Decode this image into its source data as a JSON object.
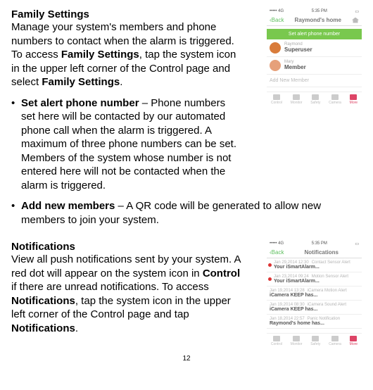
{
  "pageNumber": "12",
  "family": {
    "heading": "Family Settings",
    "intro_a": "Manage your system's members and phone numbers to contact when the alarm is  triggered. To access ",
    "intro_b": "Family Settings",
    "intro_c": ", tap the system icon in the upper left corner of the Control page and select ",
    "intro_d": "Family Settings",
    "intro_e": ".",
    "bullets": {
      "b1_bold": "Set alert phone number",
      "b1_rest": " – Phone numbers set here will be contacted by our automated phone call when the alarm is triggered. A maximum of three phone numbers can be set. Members of the system whose number is not entered here will not be contacted when the alarm is triggered.",
      "b2_bold": "Add new members",
      "b2_rest": " – A QR code will be generated to allow new members to join your system."
    }
  },
  "notifications": {
    "heading": "Notifications",
    "p_a": "View all push notifications sent by your system. A red dot will appear on the system icon in ",
    "p_b": "Control",
    "p_c": " if there are unread notifications. To access ",
    "p_d": "Notifications",
    "p_e": ", tap the system icon in the upper left corner of the Control page and tap ",
    "p_f": "Notifications",
    "p_g": "."
  },
  "phone1": {
    "status_left": "••••• 4G",
    "status_mid": "5:35 PM",
    "back": "Back",
    "title": "Raymond's home",
    "green": "Set alert phone number",
    "m1_name": "Raymond",
    "m1_role": "Superuser",
    "m2_name": "Mary",
    "m2_role": "Member",
    "add": "Add New Member",
    "tabs": {
      "t1": "Control",
      "t2": "Monitor",
      "t3": "Safety",
      "t4": "Camera",
      "t5": "More"
    }
  },
  "phone2": {
    "status_left": "••••• 4G",
    "status_mid": "5:35 PM",
    "back": "Back",
    "title": "Notifications",
    "rows": {
      "r1_date": "Jan 29,2014 12:30",
      "r1_type": "Contact Sensor Alert",
      "r1_msg": "Your iSmartAlarm...",
      "r2_date": "Jan 23,2014 09:24",
      "r2_type": "Motion Sensor Alert",
      "r2_msg": "Your iSmartAlarm...",
      "r3_date": "Jan 19,2014 13:28",
      "r3_type": "iCamera Motion Alert",
      "r3_msg": "iCamera KEEP has...",
      "r4_date": "Jan 19,2014 08:30",
      "r4_type": "iCamera Sound Alert",
      "r4_msg": "iCamera KEEP has...",
      "r5_date": "Jan 18,2014 22:57",
      "r5_type": "Panic Notification",
      "r5_msg": "Raymond's home has..."
    },
    "tabs": {
      "t1": "Control",
      "t2": "Monitor",
      "t3": "Safety",
      "t4": "Camera",
      "t5": "More"
    }
  }
}
